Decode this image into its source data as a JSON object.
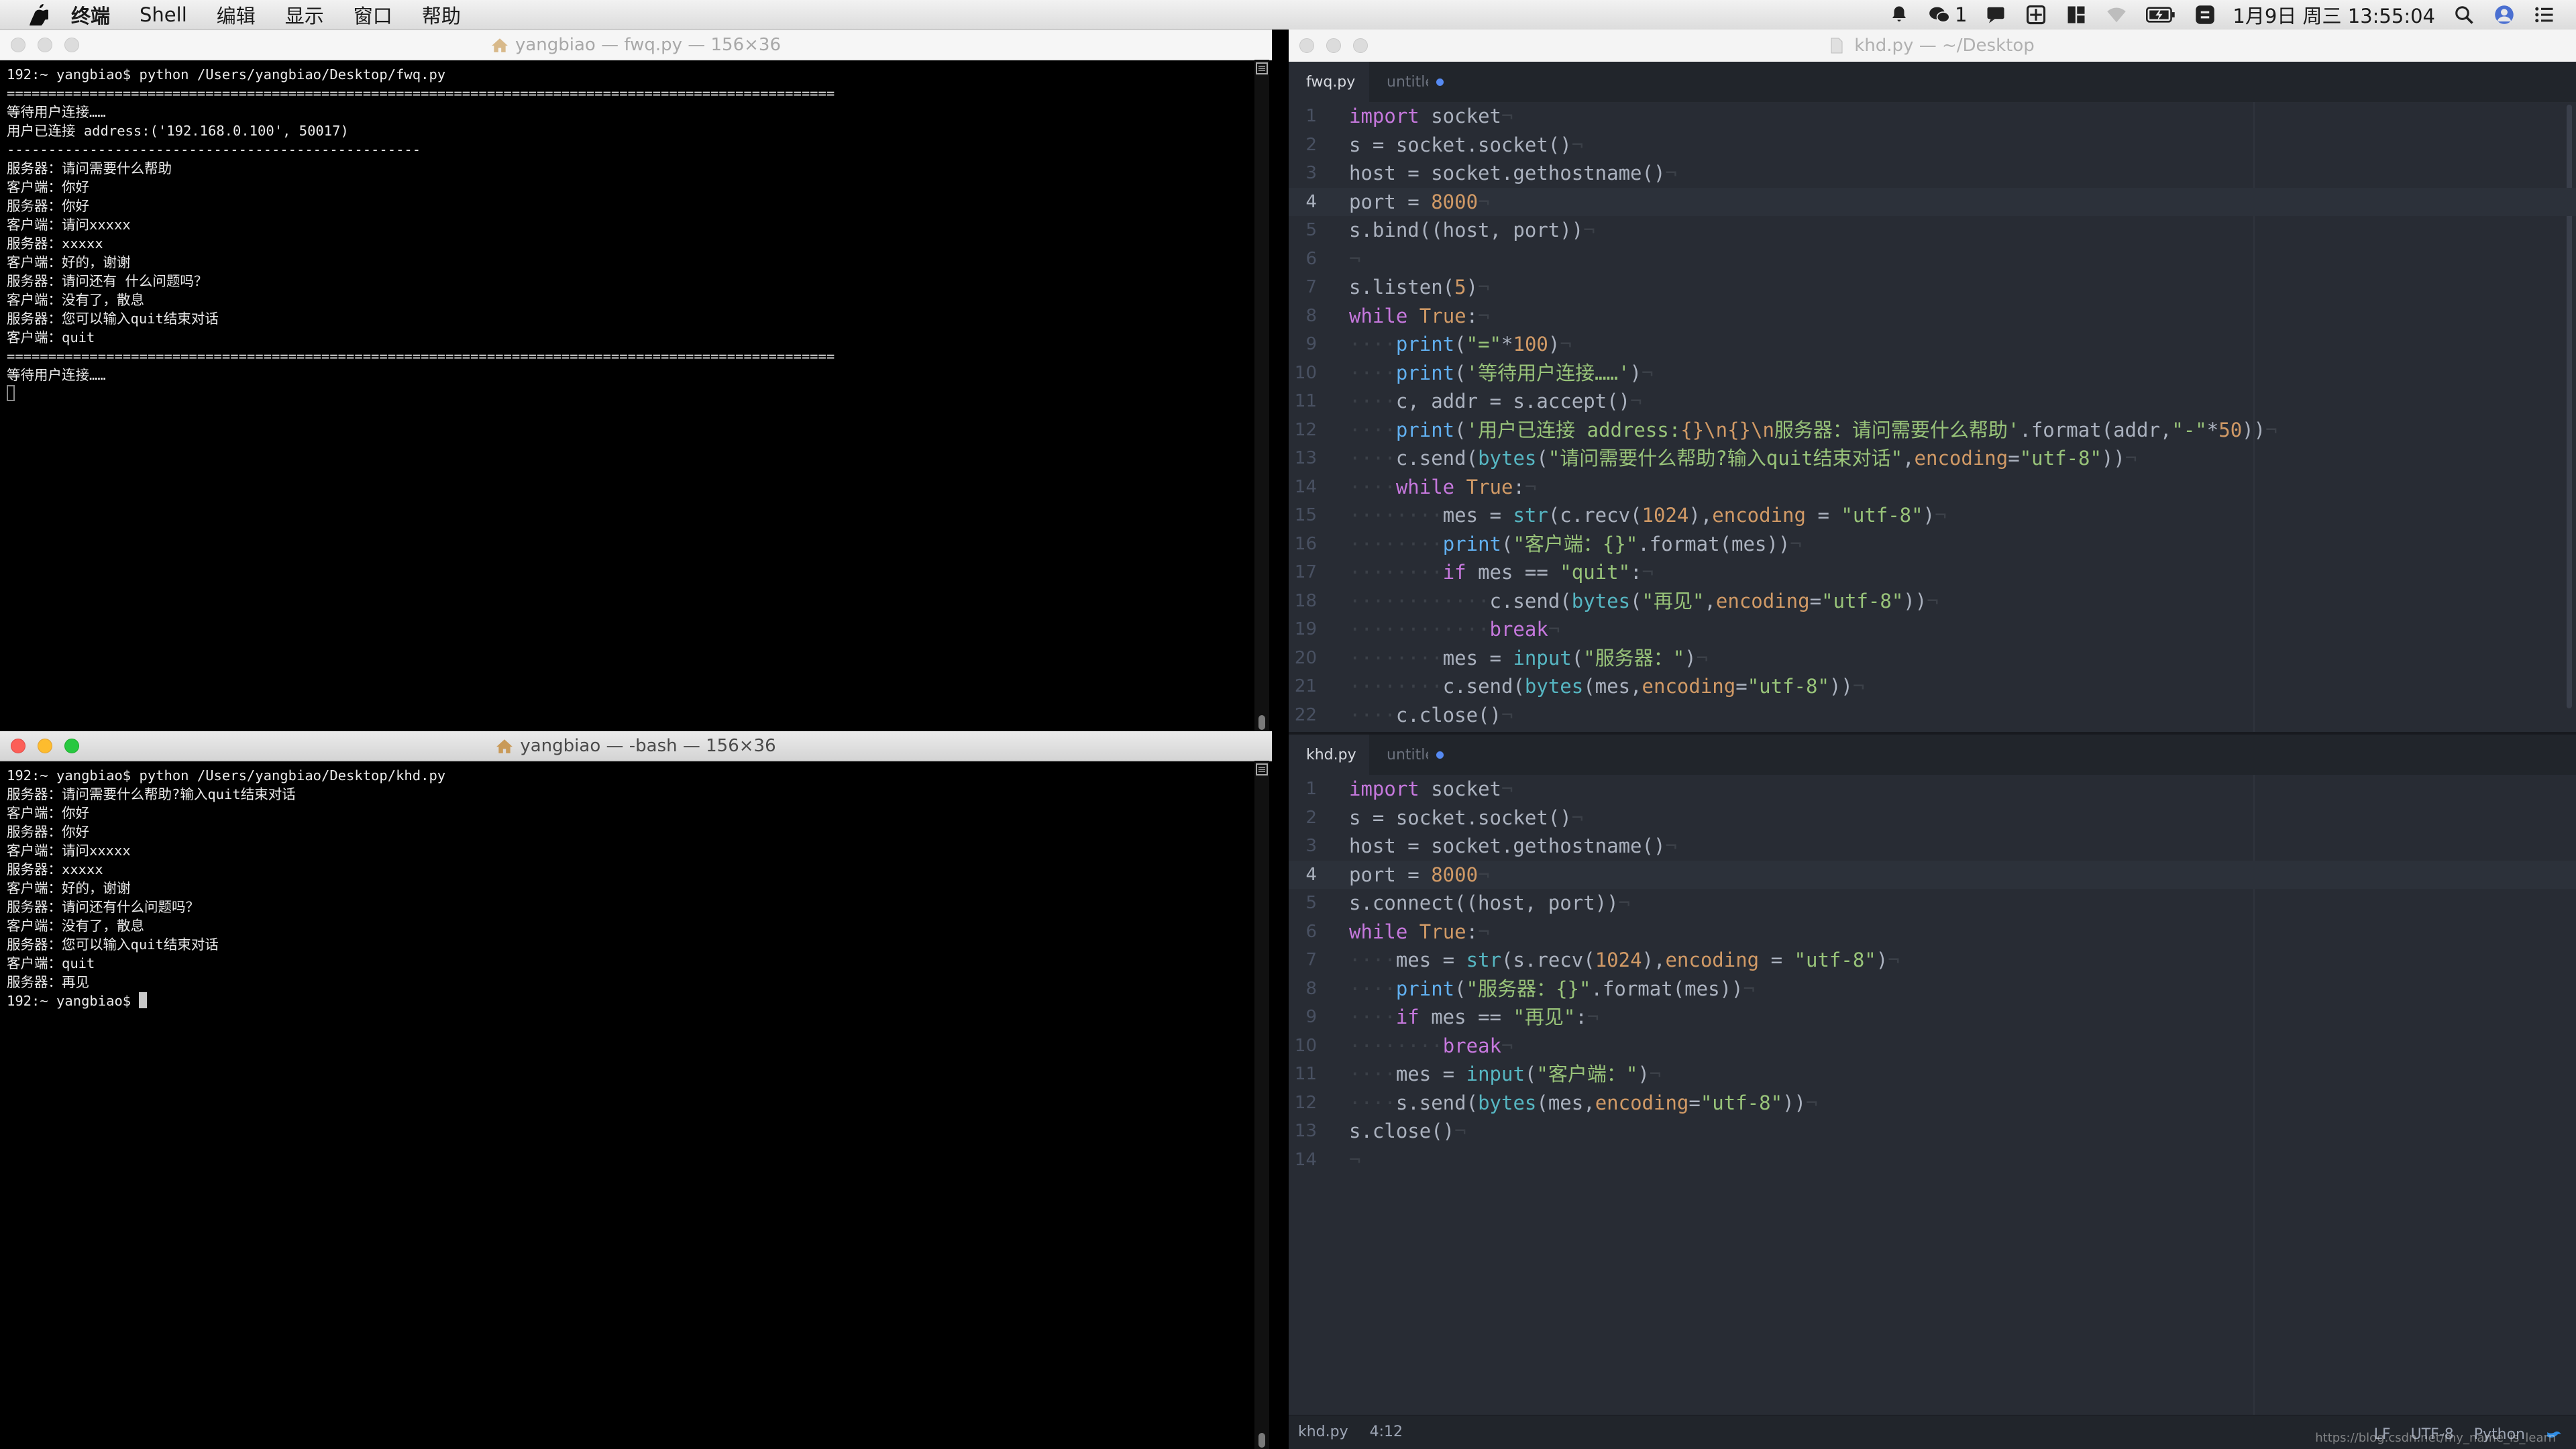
{
  "menubar": {
    "items": [
      "终端",
      "Shell",
      "编辑",
      "显示",
      "窗口",
      "帮助"
    ],
    "wechat_count": "1",
    "datetime": "1月9日 周三  13:55:04"
  },
  "terminal_top": {
    "title": "yangbiao — fwq.py — 156×36",
    "lines": [
      "192:~ yangbiao$ python /Users/yangbiao/Desktop/fwq.py",
      "====================================================================================================",
      "等待用户连接……",
      "用户已连接 address:('192.168.0.100', 50017)",
      "--------------------------------------------------",
      "服务器：请问需要什么帮助",
      "客户端：你好",
      "服务器：你好",
      "客户端：请问xxxxx",
      "服务器：xxxxx",
      "客户端：好的，谢谢",
      "服务器：请问还有 什么问题吗？",
      "客户端：没有了，散息",
      "服务器：您可以输入quit结束对话",
      "客户端：quit",
      "====================================================================================================",
      "等待用户连接……"
    ]
  },
  "terminal_bottom": {
    "title": "yangbiao — -bash — 156×36",
    "lines": [
      "192:~ yangbiao$ python /Users/yangbiao/Desktop/khd.py",
      "服务器：请问需要什么帮助?输入quit结束对话",
      "客户端：你好",
      "服务器：你好",
      "客户端：请问xxxxx",
      "服务器：xxxxx",
      "客户端：好的，谢谢",
      "服务器：请问还有什么问题吗？",
      "客户端：没有了，散息",
      "服务器：您可以输入quit结束对话",
      "客户端：quit",
      "服务器：再见"
    ],
    "prompt": "192:~ yangbiao$ "
  },
  "editor": {
    "title": "khd.py — ~/Desktop",
    "top_pane": {
      "tabs": [
        "fwq.py",
        "untitled"
      ],
      "current_line": 4,
      "lines": [
        [
          [
            "k",
            "import"
          ],
          [
            "t",
            " socket"
          ]
        ],
        [
          [
            "t",
            "s = socket.socket()"
          ]
        ],
        [
          [
            "t",
            "host = socket.gethostname()"
          ]
        ],
        [
          [
            "t",
            "port = "
          ],
          [
            "n",
            "8000"
          ]
        ],
        [
          [
            "t",
            "s.bind((host, port))"
          ]
        ],
        [],
        [
          [
            "t",
            "s.listen("
          ],
          [
            "n",
            "5"
          ],
          [
            "t",
            ")"
          ]
        ],
        [
          [
            "k",
            "while"
          ],
          [
            "t",
            " "
          ],
          [
            "n",
            "True"
          ],
          [
            "t",
            ":"
          ]
        ],
        [
          [
            "i",
            "····"
          ],
          [
            "f",
            "print"
          ],
          [
            "t",
            "("
          ],
          [
            "s",
            "\"=\""
          ],
          [
            "t",
            "*"
          ],
          [
            "n",
            "100"
          ],
          [
            "t",
            ")"
          ]
        ],
        [
          [
            "i",
            "····"
          ],
          [
            "f",
            "print"
          ],
          [
            "t",
            "("
          ],
          [
            "s",
            "'等待用户连接……'"
          ],
          [
            "t",
            ")"
          ]
        ],
        [
          [
            "i",
            "····"
          ],
          [
            "t",
            "c, addr = s.accept()"
          ]
        ],
        [
          [
            "i",
            "····"
          ],
          [
            "f",
            "print"
          ],
          [
            "t",
            "("
          ],
          [
            "s",
            "'用户已连接 address:"
          ],
          [
            "n",
            "{}\\n{}\\n"
          ],
          [
            "s",
            "服务器：请问需要什么帮助'"
          ],
          [
            "t",
            ".format(addr,"
          ],
          [
            "s",
            "\"-\""
          ],
          [
            "t",
            "*"
          ],
          [
            "n",
            "50"
          ],
          [
            "t",
            "))"
          ]
        ],
        [
          [
            "i",
            "····"
          ],
          [
            "t",
            "c.send("
          ],
          [
            "b",
            "bytes"
          ],
          [
            "t",
            "("
          ],
          [
            "s",
            "\"请问需要什么帮助?输入quit结束对话\""
          ],
          [
            "t",
            ","
          ],
          [
            "n",
            "encoding"
          ],
          [
            "t",
            "="
          ],
          [
            "s",
            "\"utf-8\""
          ],
          [
            "t",
            "))"
          ]
        ],
        [
          [
            "i",
            "····"
          ],
          [
            "k",
            "while"
          ],
          [
            "t",
            " "
          ],
          [
            "n",
            "True"
          ],
          [
            "t",
            ":"
          ]
        ],
        [
          [
            "i",
            "········"
          ],
          [
            "t",
            "mes = "
          ],
          [
            "b",
            "str"
          ],
          [
            "t",
            "(c.recv("
          ],
          [
            "n",
            "1024"
          ],
          [
            "t",
            "),"
          ],
          [
            "n",
            "encoding"
          ],
          [
            "t",
            " = "
          ],
          [
            "s",
            "\"utf-8\""
          ],
          [
            "t",
            ")"
          ]
        ],
        [
          [
            "i",
            "········"
          ],
          [
            "f",
            "print"
          ],
          [
            "t",
            "("
          ],
          [
            "s",
            "\"客户端：{}\""
          ],
          [
            "t",
            ".format(mes))"
          ]
        ],
        [
          [
            "i",
            "········"
          ],
          [
            "k",
            "if"
          ],
          [
            "t",
            " mes == "
          ],
          [
            "s",
            "\"quit\""
          ],
          [
            "t",
            ":"
          ]
        ],
        [
          [
            "i",
            "············"
          ],
          [
            "t",
            "c.send("
          ],
          [
            "b",
            "bytes"
          ],
          [
            "t",
            "("
          ],
          [
            "s",
            "\"再见\""
          ],
          [
            "t",
            ","
          ],
          [
            "n",
            "encoding"
          ],
          [
            "t",
            "="
          ],
          [
            "s",
            "\"utf-8\""
          ],
          [
            "t",
            "))"
          ]
        ],
        [
          [
            "i",
            "············"
          ],
          [
            "k",
            "break"
          ]
        ],
        [
          [
            "i",
            "········"
          ],
          [
            "t",
            "mes = "
          ],
          [
            "b",
            "input"
          ],
          [
            "t",
            "("
          ],
          [
            "s",
            "\"服务器：\""
          ],
          [
            "t",
            ")"
          ]
        ],
        [
          [
            "i",
            "········"
          ],
          [
            "t",
            "c.send("
          ],
          [
            "b",
            "bytes"
          ],
          [
            "t",
            "(mes,"
          ],
          [
            "n",
            "encoding"
          ],
          [
            "t",
            "="
          ],
          [
            "s",
            "\"utf-8\""
          ],
          [
            "t",
            "))"
          ]
        ],
        [
          [
            "i",
            "····"
          ],
          [
            "t",
            "c.close()"
          ]
        ]
      ]
    },
    "bottom_pane": {
      "tabs": [
        "khd.py",
        "untitled"
      ],
      "current_line": 4,
      "lines": [
        [
          [
            "k",
            "import"
          ],
          [
            "t",
            " socket"
          ]
        ],
        [
          [
            "t",
            "s = socket.socket()"
          ]
        ],
        [
          [
            "t",
            "host = socket.gethostname()"
          ]
        ],
        [
          [
            "t",
            "port = "
          ],
          [
            "n",
            "8000"
          ]
        ],
        [
          [
            "t",
            "s.connect((host, port))"
          ]
        ],
        [
          [
            "k",
            "while"
          ],
          [
            "t",
            " "
          ],
          [
            "n",
            "True"
          ],
          [
            "t",
            ":"
          ]
        ],
        [
          [
            "i",
            "····"
          ],
          [
            "t",
            "mes = "
          ],
          [
            "b",
            "str"
          ],
          [
            "t",
            "(s.recv("
          ],
          [
            "n",
            "1024"
          ],
          [
            "t",
            "),"
          ],
          [
            "n",
            "encoding"
          ],
          [
            "t",
            " = "
          ],
          [
            "s",
            "\"utf-8\""
          ],
          [
            "t",
            ")"
          ]
        ],
        [
          [
            "i",
            "····"
          ],
          [
            "f",
            "print"
          ],
          [
            "t",
            "("
          ],
          [
            "s",
            "\"服务器：{}\""
          ],
          [
            "t",
            ".format(mes))"
          ]
        ],
        [
          [
            "i",
            "····"
          ],
          [
            "k",
            "if"
          ],
          [
            "t",
            " mes == "
          ],
          [
            "s",
            "\"再见\""
          ],
          [
            "t",
            ":"
          ]
        ],
        [
          [
            "i",
            "········"
          ],
          [
            "k",
            "break"
          ]
        ],
        [
          [
            "i",
            "····"
          ],
          [
            "t",
            "mes = "
          ],
          [
            "b",
            "input"
          ],
          [
            "t",
            "("
          ],
          [
            "s",
            "\"客户端：\""
          ],
          [
            "t",
            ")"
          ]
        ],
        [
          [
            "i",
            "····"
          ],
          [
            "t",
            "s.send("
          ],
          [
            "b",
            "bytes"
          ],
          [
            "t",
            "(mes,"
          ],
          [
            "n",
            "encoding"
          ],
          [
            "t",
            "="
          ],
          [
            "s",
            "\"utf-8\""
          ],
          [
            "t",
            "))"
          ]
        ],
        [
          [
            "t",
            "s.close()"
          ]
        ],
        []
      ]
    },
    "statusbar": {
      "file": "khd.py",
      "cursor": "4:12",
      "line_ending": "LF",
      "encoding": "UTF-8",
      "grammar": "Python"
    },
    "watermark": "https://blog.csdn.net/my_name_is_learn"
  }
}
